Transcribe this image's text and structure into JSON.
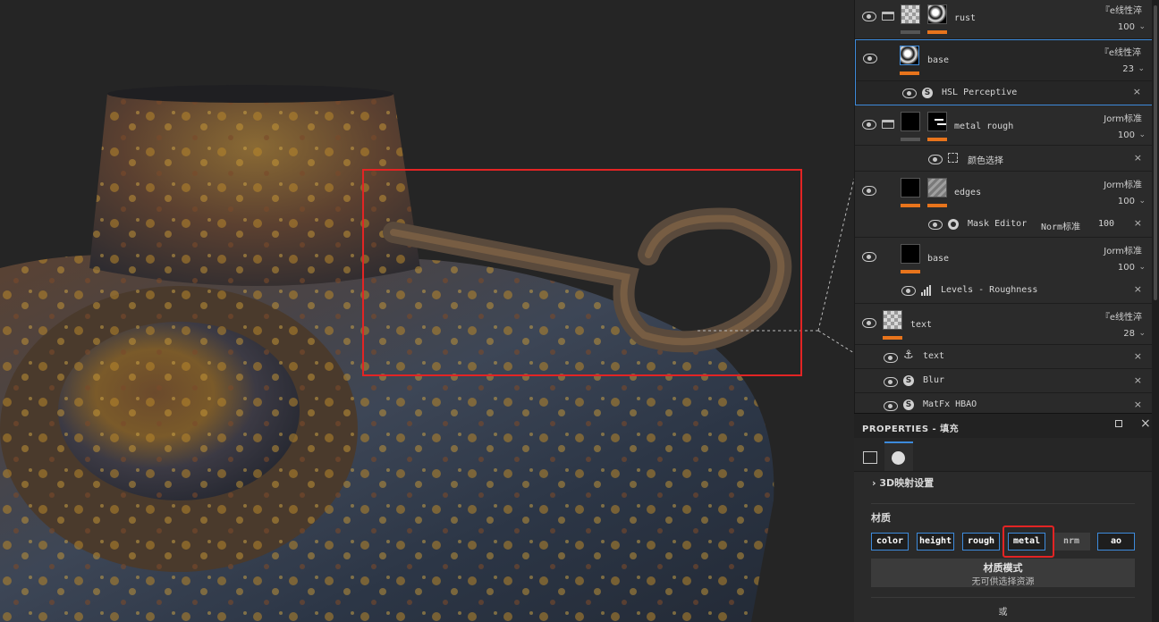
{
  "layers": [
    {
      "name": "rust",
      "blend": "『e线性淬",
      "opacity": "100",
      "folder": true
    },
    {
      "name": "base",
      "blend": "『e线性淬",
      "opacity": "23",
      "selected": true
    },
    {
      "effect": "HSL Perceptive"
    },
    {
      "name": "metal rough",
      "blend": "Jorm标准",
      "opacity": "100",
      "folder": true
    },
    {
      "effect": "颜色选择"
    },
    {
      "name": "edges",
      "blend": "Jorm标准",
      "opacity": "100"
    },
    {
      "effect": "Mask Editor",
      "blend": "Norm标准",
      "opacity": "100"
    },
    {
      "name": "base",
      "blend": "Jorm标准",
      "opacity": "100"
    },
    {
      "effect": "Levels - Roughness"
    },
    {
      "name": "text",
      "blend": "『e线性淬",
      "opacity": "28"
    },
    {
      "effect": "text"
    },
    {
      "effect": "Blur"
    },
    {
      "effect": "MatFx HBAO"
    }
  ],
  "properties": {
    "title": "PROPERTIES - 填充",
    "section_3d": "3D映射设置",
    "material_label": "材质",
    "channels": [
      "color",
      "height",
      "rough",
      "metal",
      "nrm",
      "ao"
    ],
    "mode_title": "材质模式",
    "mode_sub": "无可供选择资源",
    "or_text": "或"
  },
  "colors": {
    "accent": "#3d8bdc",
    "highlight": "#e32424",
    "layer_bar": "#e8741c"
  }
}
